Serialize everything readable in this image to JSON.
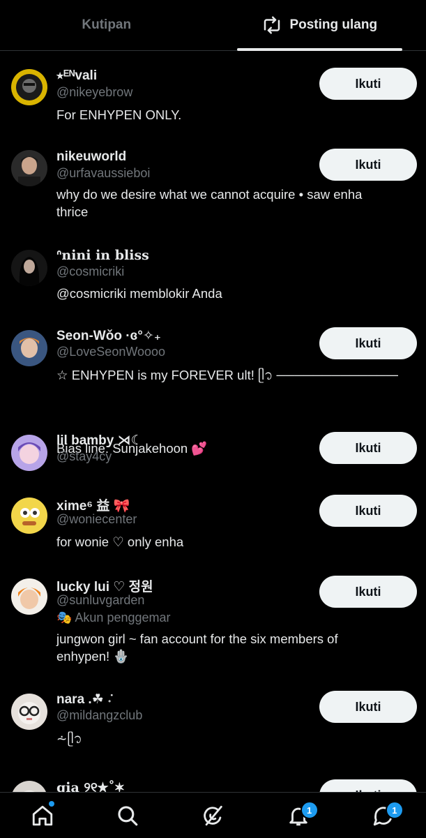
{
  "tabs": {
    "quotes": "Kutipan",
    "reposts": "Posting ulang"
  },
  "follow_label": "Ikuti",
  "users": [
    {
      "name": "⭑ᴱᴺvali",
      "handle": "@nikeyebrow",
      "bio": "For ENHYPEN ONLY."
    },
    {
      "name": "nikeuworld",
      "handle": "@urfavaussieboi",
      "bio": "why do we desire what we cannot acquire • saw enha thrice"
    },
    {
      "name": "ᐢnini in bliss",
      "handle": "@cosmicriki",
      "bio": "@cosmicriki memblokir Anda"
    },
    {
      "name": "Seon-Wǒo ·ɞ°✧₊",
      "handle": "@LoveSeonWoooo",
      "bio": "☆ ENHYPEN is my FOREVER ult! ᥫ᭡ ────────────── ɞ",
      "bio_line2": "Bias line: Sunjakehoon",
      "bio_line2_emoji": "💕"
    },
    {
      "name": "lil bamby ⋊☾",
      "handle": "@stay4cy"
    },
    {
      "name": "xime⁶ 益 🎀",
      "handle": "@woniecenter",
      "bio": "for wonie ♡ only enha"
    },
    {
      "name": "lucky lui ♡ 정원",
      "handle": "@sunluvgarden",
      "fan_label": "🎭 Akun penggemar",
      "bio": "jungwon girl ~ fan account for the six members of enhypen! 🪬"
    },
    {
      "name": "nara .☘︎ ݁˖",
      "handle": "@mildangzclub",
      "bio": "⩪ᥫ᭡"
    },
    {
      "name": "gia ୨୧★˚✶"
    }
  ],
  "nav": {
    "notifications_count": "1",
    "messages_count": "1"
  },
  "colors": {
    "accent": "#1d9bf0",
    "background": "#000000",
    "follow_bg": "#eff3f4"
  }
}
